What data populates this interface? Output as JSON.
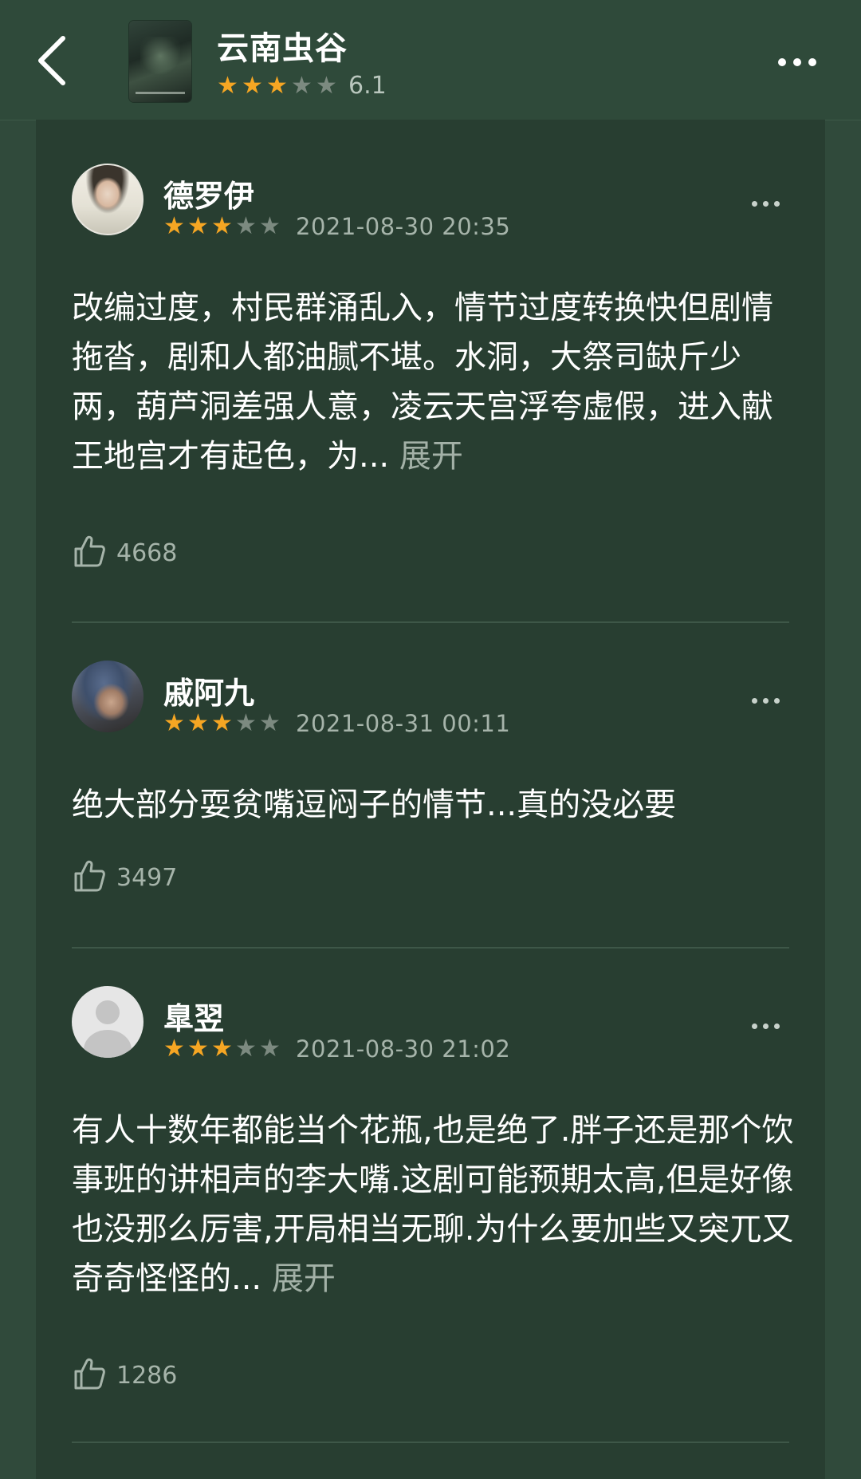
{
  "header": {
    "title": "云南虫谷",
    "stars_filled": 3,
    "stars_total": 5,
    "score": "6.1",
    "back_icon": "chevron-left-icon",
    "more_icon": "more-horizontal-icon"
  },
  "colors": {
    "star_on": "#f6a623",
    "star_off": "#7c8a80",
    "background": "#304a3b",
    "panel": "#283e31"
  },
  "reviews": [
    {
      "username": "德罗伊",
      "stars_filled": 3,
      "date": "2021-08-30 20:35",
      "text": "改编过度，村民群涌乱入，情节过度转换快但剧情拖沓，剧和人都油腻不堪。水洞，大祭司缺斤少两，葫芦洞差强人意，凌云天宫浮夸虚假，进入献王地宫才有起色，为...",
      "expand_label": "展开",
      "likes": "4668"
    },
    {
      "username": "戚阿九",
      "stars_filled": 3,
      "date": "2021-08-31 00:11",
      "text": "绝大部分耍贫嘴逗闷子的情节...真的没必要",
      "likes": "3497"
    },
    {
      "username": "臯翌",
      "stars_filled": 3,
      "date": "2021-08-30 21:02",
      "text": "有人十数年都能当个花瓶,也是绝了.胖子还是那个饮事班的讲相声的李大嘴.这剧可能预期太高,但是好像也没那么厉害,开局相当无聊.为什么要加些又突兀又奇奇怪怪的...",
      "expand_label": "展开",
      "likes": "1286"
    }
  ]
}
